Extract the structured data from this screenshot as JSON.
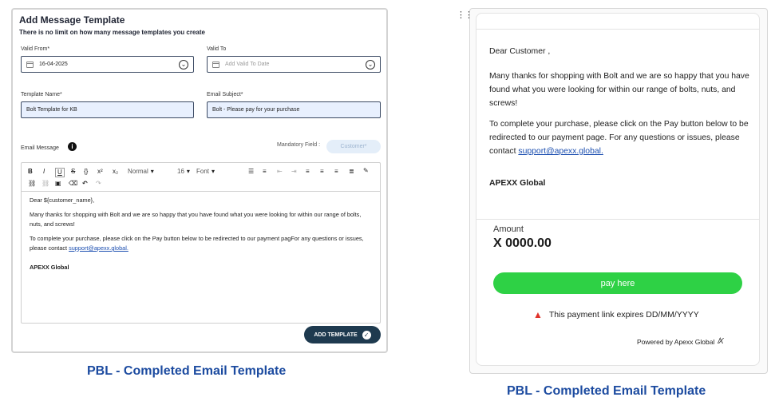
{
  "left": {
    "title": "Add Message Template",
    "subtitle": "There is no limit on how many message templates you create",
    "valid_from": {
      "label": "Valid From*",
      "value": "16-04-2025"
    },
    "valid_to": {
      "label": "Valid To",
      "placeholder": "Add Valid To Date"
    },
    "template_name": {
      "label": "Template Name*",
      "value": "Bolt Template for KB"
    },
    "email_subject": {
      "label": "Email Subject*",
      "value": "Bolt - Please pay for your purchase"
    },
    "email_message_label": "Email Message",
    "mandatory_label": "Mandatory Field :",
    "mandatory_pill": "Customer*",
    "toolbar": {
      "format_select": "Normal",
      "size_select": "16",
      "font_select": "Font"
    },
    "editor": {
      "greeting": "Dear ${customer_name},",
      "para1": "Many thanks for shopping with Bolt and we are so happy that you have found what you were looking for within our range of bolts, nuts, and screws!",
      "para2_text": "To complete your purchase, please click on the Pay button below to be redirected to our payment pagFor any questions or issues, please contact ",
      "para2_link": "support@apexx.global.",
      "signature": "APEXX Global"
    },
    "add_button": "ADD TEMPLATE",
    "caption": "PBL - Completed Email Template"
  },
  "right": {
    "greeting": "Dear  Customer ,",
    "para1": "Many thanks for shopping with Bolt and we are so happy that you have found what you were looking for within our range of bolts, nuts, and screws!",
    "para2_text": "To complete your purchase, please click on the Pay button below to be redirected to our payment page. For any questions or issues, please contact ",
    "para2_link": "support@apexx.global.",
    "signature": "APEXX Global",
    "amount_label": "Amount",
    "amount_value": "X 0000.00",
    "pay_button": "pay here",
    "expiry": "This payment link expires DD/MM/YYYY",
    "powered_by": "Powered by Apexx Global",
    "caption": "PBL - Completed Email Template"
  },
  "colors": {
    "accent_button": "#1e3a4f",
    "pay_button": "#2ed145",
    "caption": "#1c4ba0",
    "warning": "#e0332b",
    "link": "#1b4eb0"
  }
}
